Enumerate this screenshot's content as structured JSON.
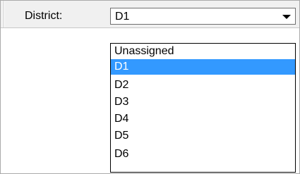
{
  "district": {
    "label": "District:",
    "selected_value": "D1",
    "arrow_icon": "chevron-down-icon",
    "options": [
      "Unassigned",
      "D1",
      "D2",
      "D3",
      "D4",
      "D5",
      "D6"
    ],
    "highlighted_index": 1
  },
  "colors": {
    "highlight": "#3399ff",
    "highlight_text": "#ffffff"
  }
}
